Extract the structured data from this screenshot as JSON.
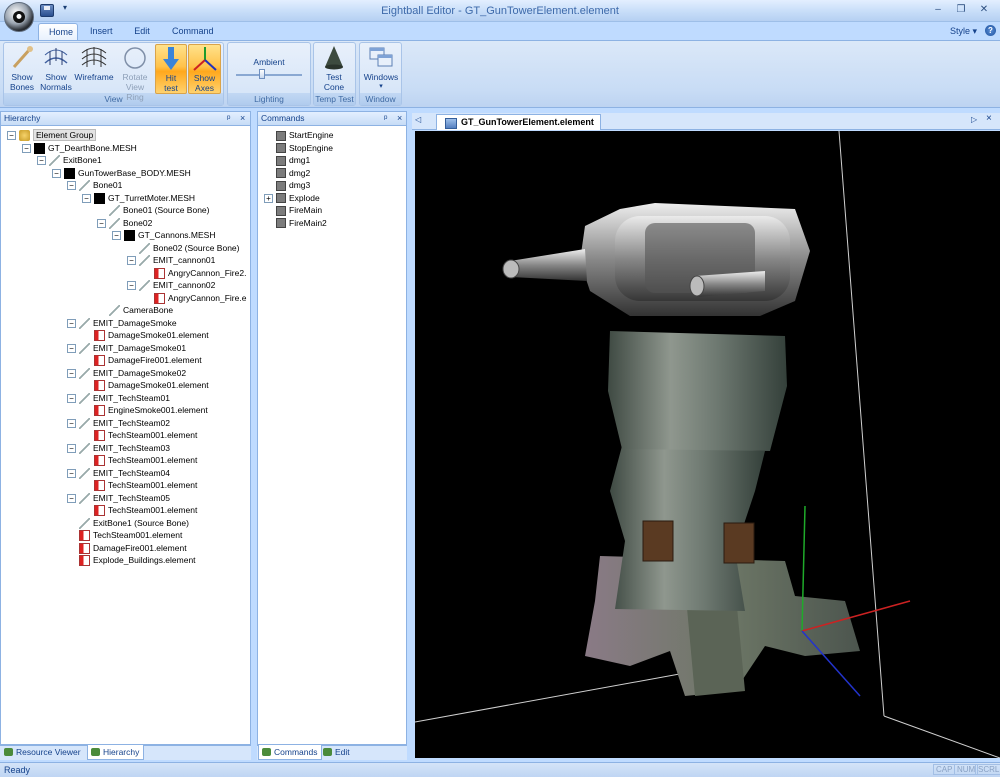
{
  "app": {
    "title": "Eightball Editor - GT_GunTowerElement.element"
  },
  "window_buttons": {
    "minimize": "–",
    "restore": "❐",
    "close": "✕"
  },
  "quick_access": {
    "more": "▾"
  },
  "ribbon": {
    "tabs": [
      "Home",
      "Insert",
      "Edit",
      "Command"
    ],
    "active_tab": "Home",
    "style_label": "Style",
    "help": "?",
    "groups": {
      "view": {
        "label": "View",
        "buttons": [
          {
            "label1": "Show",
            "label2": "Bones",
            "icon": "bones-icon"
          },
          {
            "label1": "Show",
            "label2": "Normals",
            "icon": "normals-icon"
          },
          {
            "label1": "Wireframe",
            "label2": "",
            "icon": "wireframe-icon"
          },
          {
            "label1": "Rotate",
            "label2": "View Ring",
            "icon": "view-ring-icon",
            "disabled": true
          },
          {
            "label1": "Hit",
            "label2": "test",
            "icon": "hit-test-icon",
            "active": true
          },
          {
            "label1": "Show",
            "label2": "Axes",
            "icon": "axes-icon",
            "active": true
          }
        ]
      },
      "lighting": {
        "label": "Lighting",
        "slider_label": "Ambient"
      },
      "temp_test": {
        "label": "Temp Test",
        "button1": "Test",
        "button2": "Cone"
      },
      "window": {
        "label": "Window",
        "button": "Windows"
      }
    }
  },
  "hierarchy": {
    "title": "Hierarchy",
    "pin": "ᵖ",
    "close": "×",
    "items": [
      {
        "text": "Element Group",
        "indent": 0,
        "icon": "grp",
        "exp": "−",
        "sel": true
      },
      {
        "text": "GT_DearthBone.MESH",
        "indent": 1,
        "icon": "mesh",
        "exp": "−"
      },
      {
        "text": "ExitBone1",
        "indent": 2,
        "icon": "bone",
        "exp": "−"
      },
      {
        "text": "GunTowerBase_BODY.MESH",
        "indent": 3,
        "icon": "mesh",
        "exp": "−"
      },
      {
        "text": "Bone01",
        "indent": 4,
        "icon": "bone",
        "exp": "−"
      },
      {
        "text": "GT_TurretMoter.MESH",
        "indent": 5,
        "icon": "mesh",
        "exp": "−"
      },
      {
        "text": "Bone01 (Source Bone)",
        "indent": 6,
        "icon": "bone",
        "exp": ""
      },
      {
        "text": "Bone02",
        "indent": 6,
        "icon": "bone",
        "exp": "−"
      },
      {
        "text": "GT_Cannons.MESH",
        "indent": 7,
        "icon": "mesh",
        "exp": "−"
      },
      {
        "text": "Bone02 (Source Bone)",
        "indent": 8,
        "icon": "bone",
        "exp": ""
      },
      {
        "text": "EMIT_cannon01",
        "indent": 8,
        "icon": "bone",
        "exp": "−"
      },
      {
        "text": "AngryCannon_Fire2.",
        "indent": 9,
        "icon": "el",
        "exp": ""
      },
      {
        "text": "EMIT_cannon02",
        "indent": 8,
        "icon": "bone",
        "exp": "−"
      },
      {
        "text": "AngryCannon_Fire.e",
        "indent": 9,
        "icon": "el",
        "exp": ""
      },
      {
        "text": "CameraBone",
        "indent": 6,
        "icon": "bone",
        "exp": ""
      },
      {
        "text": "EMIT_DamageSmoke",
        "indent": 4,
        "icon": "bone",
        "exp": "−"
      },
      {
        "text": "DamageSmoke01.element",
        "indent": 5,
        "icon": "el",
        "exp": ""
      },
      {
        "text": "EMIT_DamageSmoke01",
        "indent": 4,
        "icon": "bone",
        "exp": "−"
      },
      {
        "text": "DamageFire001.element",
        "indent": 5,
        "icon": "el",
        "exp": ""
      },
      {
        "text": "EMIT_DamageSmoke02",
        "indent": 4,
        "icon": "bone",
        "exp": "−"
      },
      {
        "text": "DamageSmoke01.element",
        "indent": 5,
        "icon": "el",
        "exp": ""
      },
      {
        "text": "EMIT_TechSteam01",
        "indent": 4,
        "icon": "bone",
        "exp": "−"
      },
      {
        "text": "EngineSmoke001.element",
        "indent": 5,
        "icon": "el",
        "exp": ""
      },
      {
        "text": "EMIT_TechSteam02",
        "indent": 4,
        "icon": "bone",
        "exp": "−"
      },
      {
        "text": "TechSteam001.element",
        "indent": 5,
        "icon": "el",
        "exp": ""
      },
      {
        "text": "EMIT_TechSteam03",
        "indent": 4,
        "icon": "bone",
        "exp": "−"
      },
      {
        "text": "TechSteam001.element",
        "indent": 5,
        "icon": "el",
        "exp": ""
      },
      {
        "text": "EMIT_TechSteam04",
        "indent": 4,
        "icon": "bone",
        "exp": "−"
      },
      {
        "text": "TechSteam001.element",
        "indent": 5,
        "icon": "el",
        "exp": ""
      },
      {
        "text": "EMIT_TechSteam05",
        "indent": 4,
        "icon": "bone",
        "exp": "−"
      },
      {
        "text": "TechSteam001.element",
        "indent": 5,
        "icon": "el",
        "exp": ""
      },
      {
        "text": "ExitBone1 (Source Bone)",
        "indent": 4,
        "icon": "bone",
        "exp": ""
      },
      {
        "text": "TechSteam001.element",
        "indent": 4,
        "icon": "el",
        "exp": ""
      },
      {
        "text": "DamageFire001.element",
        "indent": 4,
        "icon": "el",
        "exp": ""
      },
      {
        "text": "Explode_Buildings.element",
        "indent": 4,
        "icon": "el",
        "exp": ""
      }
    ]
  },
  "commands": {
    "title": "Commands",
    "pin": "ᵖ",
    "close": "×",
    "items": [
      {
        "text": "StartEngine",
        "exp": ""
      },
      {
        "text": "StopEngine",
        "exp": ""
      },
      {
        "text": "dmg1",
        "exp": ""
      },
      {
        "text": "dmg2",
        "exp": ""
      },
      {
        "text": "dmg3",
        "exp": ""
      },
      {
        "text": "Explode",
        "exp": "+"
      },
      {
        "text": "FireMain",
        "exp": ""
      },
      {
        "text": "FireMain2",
        "exp": ""
      }
    ]
  },
  "bottom_tabs_left": [
    "Resource Viewer",
    "Hierarchy"
  ],
  "bottom_tabs_mid": [
    "Commands",
    "Edit"
  ],
  "document": {
    "tab": "GT_GunTowerElement.element",
    "nav_left": "◁",
    "nav_right": "▷",
    "close": "×"
  },
  "status": {
    "text": "Ready",
    "indicators": [
      "CAP",
      "NUM",
      "SCRL"
    ]
  }
}
